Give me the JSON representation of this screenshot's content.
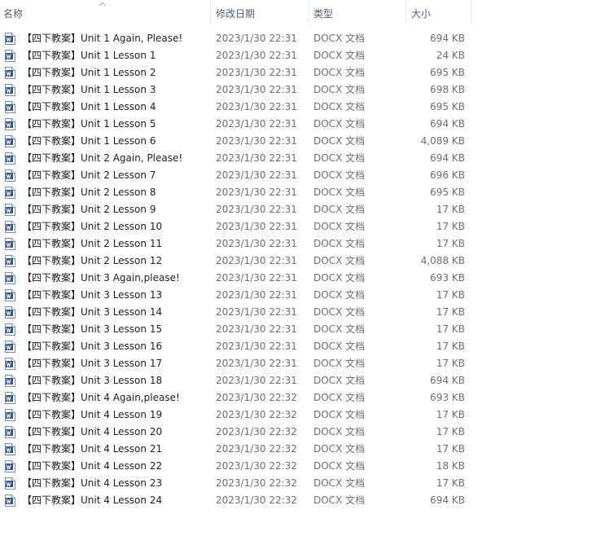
{
  "columns": {
    "name": "名称",
    "date": "修改日期",
    "type": "类型",
    "size": "大小"
  },
  "icon": "word-document-icon",
  "colors": {
    "header_text": "#4c607a",
    "icon_blue": "#2b5797",
    "secondary_text": "#6d6d6d"
  },
  "files": [
    {
      "name": "【四下教案】Unit 1 Again, Please!",
      "date": "2023/1/30 22:31",
      "type": "DOCX 文档",
      "size": "694 KB"
    },
    {
      "name": "【四下教案】Unit 1 Lesson 1",
      "date": "2023/1/30 22:31",
      "type": "DOCX 文档",
      "size": "24 KB"
    },
    {
      "name": "【四下教案】Unit 1 Lesson 2",
      "date": "2023/1/30 22:31",
      "type": "DOCX 文档",
      "size": "695 KB"
    },
    {
      "name": "【四下教案】Unit 1 Lesson 3",
      "date": "2023/1/30 22:31",
      "type": "DOCX 文档",
      "size": "698 KB"
    },
    {
      "name": "【四下教案】Unit 1 Lesson 4",
      "date": "2023/1/30 22:31",
      "type": "DOCX 文档",
      "size": "695 KB"
    },
    {
      "name": "【四下教案】Unit 1 Lesson 5",
      "date": "2023/1/30 22:31",
      "type": "DOCX 文档",
      "size": "694 KB"
    },
    {
      "name": "【四下教案】Unit 1 Lesson 6",
      "date": "2023/1/30 22:31",
      "type": "DOCX 文档",
      "size": "4,089 KB"
    },
    {
      "name": "【四下教案】Unit 2 Again, Please!",
      "date": "2023/1/30 22:31",
      "type": "DOCX 文档",
      "size": "694 KB"
    },
    {
      "name": "【四下教案】Unit 2 Lesson 7",
      "date": "2023/1/30 22:31",
      "type": "DOCX 文档",
      "size": "696 KB"
    },
    {
      "name": "【四下教案】Unit 2 Lesson 8",
      "date": "2023/1/30 22:31",
      "type": "DOCX 文档",
      "size": "695 KB"
    },
    {
      "name": "【四下教案】Unit 2 Lesson 9",
      "date": "2023/1/30 22:31",
      "type": "DOCX 文档",
      "size": "17 KB"
    },
    {
      "name": "【四下教案】Unit 2 Lesson 10",
      "date": "2023/1/30 22:31",
      "type": "DOCX 文档",
      "size": "17 KB"
    },
    {
      "name": "【四下教案】Unit 2 Lesson 11",
      "date": "2023/1/30 22:31",
      "type": "DOCX 文档",
      "size": "17 KB"
    },
    {
      "name": "【四下教案】Unit 2 Lesson 12",
      "date": "2023/1/30 22:31",
      "type": "DOCX 文档",
      "size": "4,088 KB"
    },
    {
      "name": "【四下教案】Unit 3 Again,please!",
      "date": "2023/1/30 22:31",
      "type": "DOCX 文档",
      "size": "693 KB"
    },
    {
      "name": "【四下教案】Unit 3 Lesson 13",
      "date": "2023/1/30 22:31",
      "type": "DOCX 文档",
      "size": "17 KB"
    },
    {
      "name": "【四下教案】Unit 3 Lesson 14",
      "date": "2023/1/30 22:31",
      "type": "DOCX 文档",
      "size": "17 KB"
    },
    {
      "name": "【四下教案】Unit 3 Lesson 15",
      "date": "2023/1/30 22:31",
      "type": "DOCX 文档",
      "size": "17 KB"
    },
    {
      "name": "【四下教案】Unit 3 Lesson 16",
      "date": "2023/1/30 22:31",
      "type": "DOCX 文档",
      "size": "17 KB"
    },
    {
      "name": "【四下教案】Unit 3 Lesson 17",
      "date": "2023/1/30 22:31",
      "type": "DOCX 文档",
      "size": "17 KB"
    },
    {
      "name": "【四下教案】Unit 3 Lesson 18",
      "date": "2023/1/30 22:31",
      "type": "DOCX 文档",
      "size": "694 KB"
    },
    {
      "name": "【四下教案】Unit 4 Again,please!",
      "date": "2023/1/30 22:32",
      "type": "DOCX 文档",
      "size": "693 KB"
    },
    {
      "name": "【四下教案】Unit 4 Lesson 19",
      "date": "2023/1/30 22:32",
      "type": "DOCX 文档",
      "size": "17 KB"
    },
    {
      "name": "【四下教案】Unit 4 Lesson 20",
      "date": "2023/1/30 22:32",
      "type": "DOCX 文档",
      "size": "17 KB"
    },
    {
      "name": "【四下教案】Unit 4 Lesson 21",
      "date": "2023/1/30 22:32",
      "type": "DOCX 文档",
      "size": "17 KB"
    },
    {
      "name": "【四下教案】Unit 4 Lesson 22",
      "date": "2023/1/30 22:32",
      "type": "DOCX 文档",
      "size": "18 KB"
    },
    {
      "name": "【四下教案】Unit 4 Lesson 23",
      "date": "2023/1/30 22:32",
      "type": "DOCX 文档",
      "size": "17 KB"
    },
    {
      "name": "【四下教案】Unit 4 Lesson 24",
      "date": "2023/1/30 22:32",
      "type": "DOCX 文档",
      "size": "694 KB"
    }
  ]
}
